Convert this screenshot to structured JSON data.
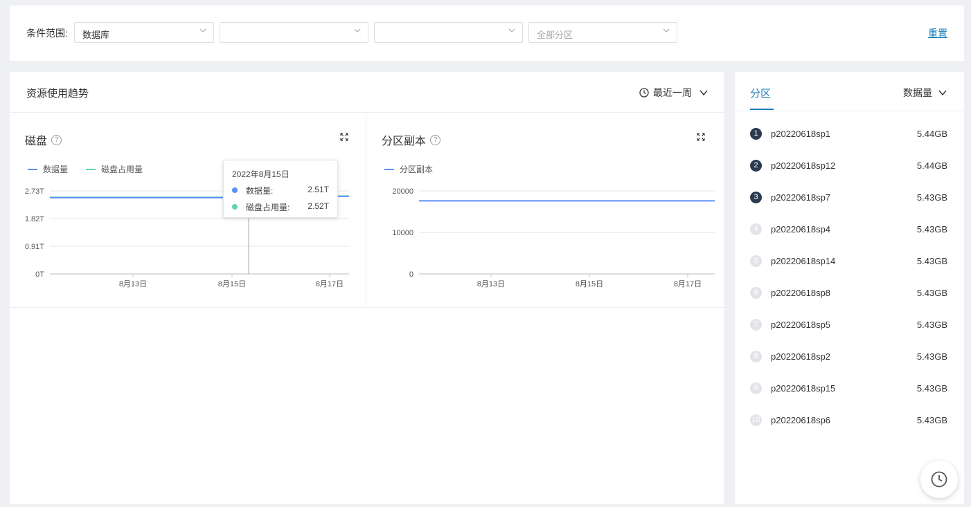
{
  "filter": {
    "label": "条件范围:",
    "selects": [
      {
        "value": "数据库",
        "placeholder": false
      },
      {
        "value": "",
        "placeholder": false
      },
      {
        "value": "",
        "placeholder": false
      },
      {
        "value": "全部分区",
        "placeholder": true
      }
    ],
    "reset": "重置"
  },
  "trend": {
    "title": "资源使用趋势",
    "range_label": "最近一周",
    "range_icon": "clock-icon"
  },
  "disk_chart": {
    "title": "磁盘",
    "legend": [
      {
        "name": "数据量",
        "color": "#5b8ff9"
      },
      {
        "name": "磁盘占用量",
        "color": "#5ad8a6"
      }
    ],
    "tooltip": {
      "date": "2022年8月15日",
      "rows": [
        {
          "label": "数据量:",
          "value": "2.51T",
          "color": "#5b8ff9"
        },
        {
          "label": "磁盘占用量:",
          "value": "2.52T",
          "color": "#5ad8a6"
        }
      ]
    }
  },
  "replica_chart": {
    "title": "分区副本",
    "legend": [
      {
        "name": "分区副本",
        "color": "#5b8ff9"
      }
    ]
  },
  "chart_data": [
    {
      "type": "line",
      "title": "磁盘",
      "x_ticks": [
        "8月13日",
        "8月15日",
        "8月17日"
      ],
      "y_ticks": [
        "0T",
        "0.91T",
        "1.82T",
        "2.73T"
      ],
      "ylim": [
        0,
        2.73
      ],
      "x": [
        0,
        1,
        2,
        3,
        4,
        5,
        6,
        7
      ],
      "series": [
        {
          "name": "数据量",
          "color": "#5b8ff9",
          "values": [
            2.51,
            2.51,
            2.51,
            2.51,
            2.51,
            2.51,
            2.55,
            2.55
          ]
        },
        {
          "name": "磁盘占用量",
          "color": "#5ad8a6",
          "values": [
            2.52,
            2.52,
            2.52,
            2.52,
            2.52,
            2.52,
            2.56,
            2.56
          ]
        }
      ],
      "legend": "top-left",
      "grid": true
    },
    {
      "type": "line",
      "title": "分区副本",
      "x_ticks": [
        "8月13日",
        "8月15日",
        "8月17日"
      ],
      "y_ticks": [
        "0",
        "10000",
        "20000"
      ],
      "ylim": [
        0,
        20000
      ],
      "x": [
        0,
        1,
        2,
        3,
        4,
        5,
        6
      ],
      "series": [
        {
          "name": "分区副本",
          "color": "#5b8ff9",
          "values": [
            17600,
            17600,
            17600,
            17600,
            17600,
            17600,
            17600
          ]
        }
      ],
      "legend": "top-left",
      "grid": true
    }
  ],
  "partitions": {
    "tab": "分区",
    "sort_label": "数据量",
    "items": [
      {
        "rank": "1",
        "name": "p20220618sp1",
        "size": "5.44GB",
        "top": true
      },
      {
        "rank": "2",
        "name": "p20220618sp12",
        "size": "5.44GB",
        "top": true
      },
      {
        "rank": "3",
        "name": "p20220618sp7",
        "size": "5.43GB",
        "top": true
      },
      {
        "rank": "4",
        "name": "p20220618sp4",
        "size": "5.43GB",
        "top": false
      },
      {
        "rank": "5",
        "name": "p20220618sp14",
        "size": "5.43GB",
        "top": false
      },
      {
        "rank": "6",
        "name": "p20220618sp8",
        "size": "5.43GB",
        "top": false
      },
      {
        "rank": "7",
        "name": "p20220618sp5",
        "size": "5.43GB",
        "top": false
      },
      {
        "rank": "8",
        "name": "p20220618sp2",
        "size": "5.43GB",
        "top": false
      },
      {
        "rank": "9",
        "name": "p20220618sp15",
        "size": "5.43GB",
        "top": false
      },
      {
        "rank": "10",
        "name": "p20220618sp6",
        "size": "5.43GB",
        "top": false
      }
    ]
  },
  "floating_button_icon": "history-clock-icon"
}
